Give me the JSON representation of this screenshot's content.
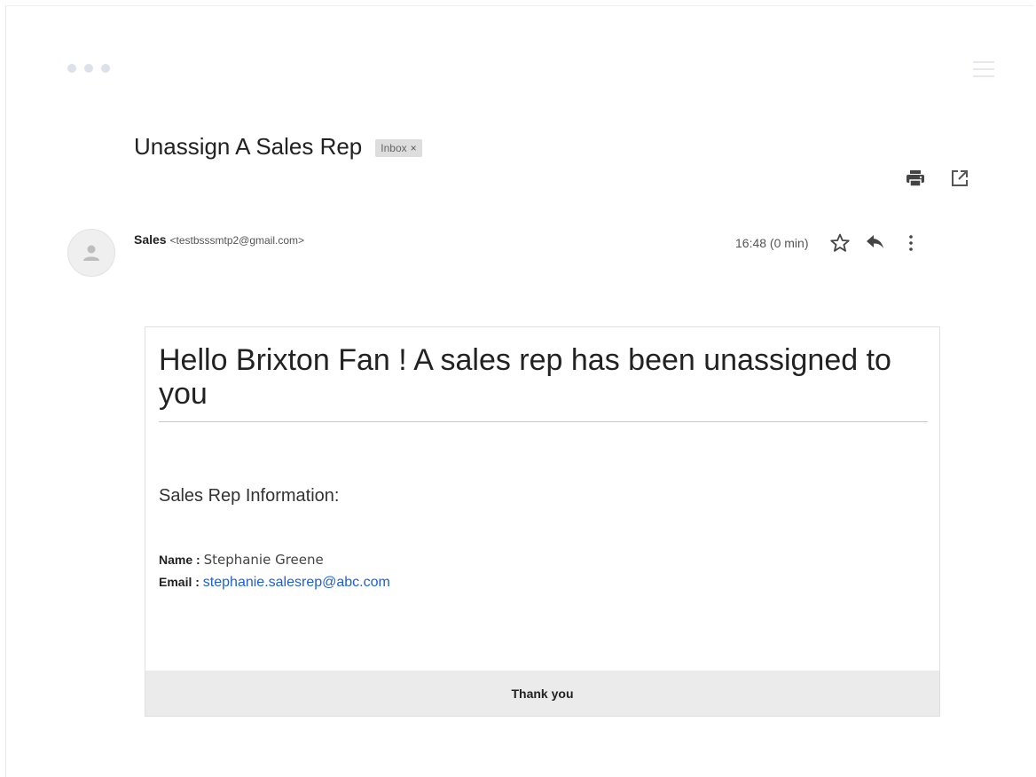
{
  "window": {
    "dots": [
      "dot",
      "dot",
      "dot"
    ],
    "menu_icon": "hamburger-menu-icon"
  },
  "subject": {
    "title": "Unassign A Sales Rep",
    "label": "Inbox",
    "label_close": "×"
  },
  "toolbar": {
    "print_icon": "print-icon",
    "open_new_window_icon": "open-in-new-window-icon"
  },
  "message": {
    "sender_name": "Sales",
    "sender_email": "<testbsssmtp2@gmail.com>",
    "time": "16:48 (0 min)",
    "star_icon": "star-outline-icon",
    "reply_icon": "reply-icon",
    "more_icon": "more-vertical-icon",
    "avatar_icon": "person-avatar-icon"
  },
  "body": {
    "headline": "Hello Brixton Fan ! A sales rep has been unassigned to you",
    "section_title": "Sales Rep Information:",
    "name_label": "Name :",
    "name_value": "Stephanie Greene",
    "email_label": "Email :",
    "email_value": "stephanie.salesrep@abc.com",
    "footer": "Thank you"
  },
  "colors": {
    "link": "#1f5fd6",
    "footer_bg": "#ebebeb",
    "chip_bg": "#dddddd"
  }
}
